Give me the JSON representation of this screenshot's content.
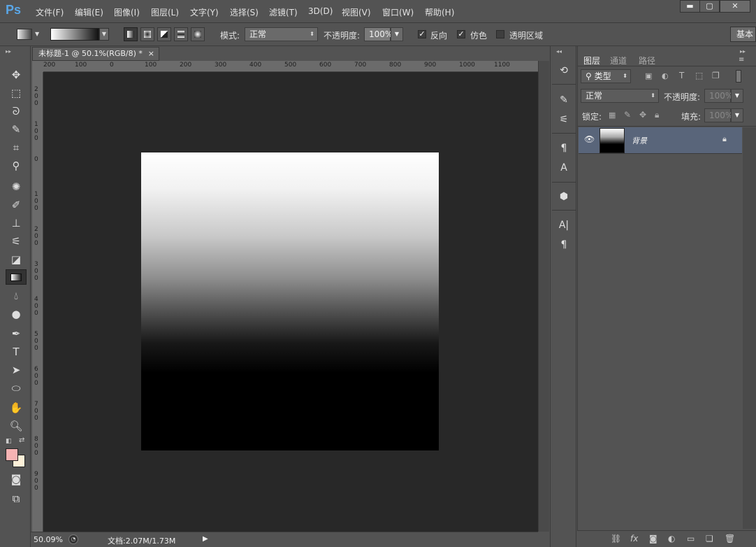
{
  "app": {
    "logo": "Ps"
  },
  "menu": [
    "文件(F)",
    "编辑(E)",
    "图像(I)",
    "图层(L)",
    "文字(Y)",
    "选择(S)",
    "滤镜(T)",
    "3D(D)",
    "视图(V)",
    "窗口(W)",
    "帮助(H)"
  ],
  "window_controls": {
    "minimize": "▬",
    "restore": "▢",
    "close": "✕"
  },
  "options": {
    "mode_label": "模式:",
    "mode_value": "正常",
    "opacity_label": "不透明度:",
    "opacity_value": "100%",
    "reverse_label": "反向",
    "dither_label": "仿色",
    "transparency_label": "透明区域",
    "workspace": "基本",
    "reverse_checked": true,
    "dither_checked": true,
    "transparency_checked": false
  },
  "document": {
    "tab_title": "未标题-1 @ 50.1%(RGB/8) *",
    "tab_close": "×",
    "ruler_top": [
      "200",
      "100",
      "0",
      "100",
      "200",
      "300",
      "400",
      "500",
      "600",
      "700",
      "800",
      "900",
      "1000",
      "1100"
    ],
    "ruler_left": [
      "200",
      "100",
      "0",
      "100",
      "200",
      "300",
      "400",
      "500",
      "600",
      "700",
      "800",
      "900"
    ]
  },
  "status": {
    "zoom": "50.09%",
    "doc_info": "文档:2.07M/1.73M",
    "arrow": "▶"
  },
  "layers_panel": {
    "tabs": [
      "图层",
      "通道",
      "路径"
    ],
    "filter_type": "类型",
    "blend_mode": "正常",
    "opacity_label": "不透明度:",
    "opacity_value": "100%",
    "lock_label": "锁定:",
    "fill_label": "填充:",
    "fill_value": "100%",
    "layer_name": "背景"
  },
  "colors": {
    "foreground": "#f7b3b3",
    "background": "#fdf0d8",
    "selected_layer": "#59657a"
  }
}
